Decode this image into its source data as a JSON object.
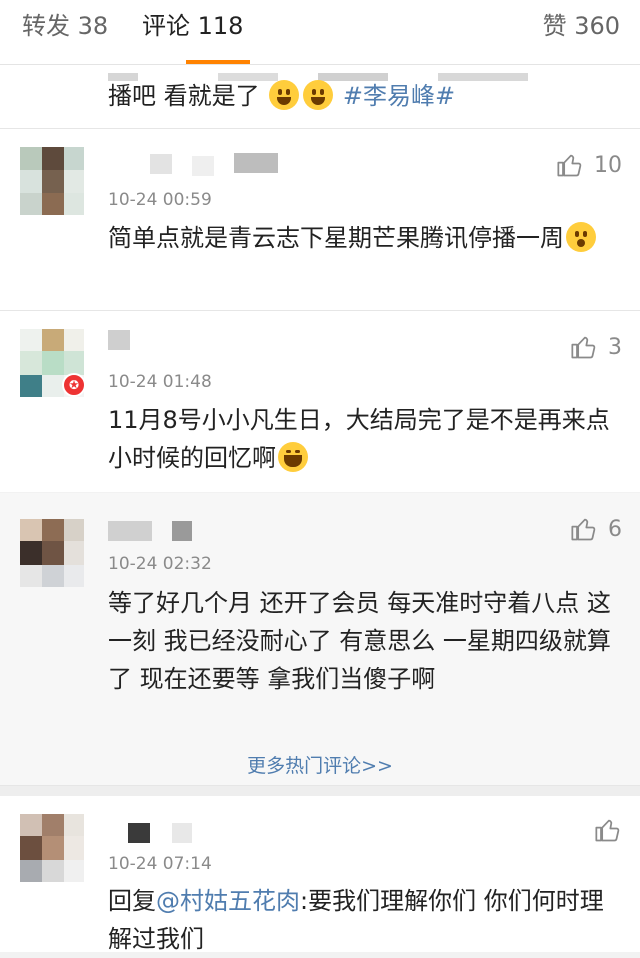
{
  "tabs": {
    "repost": "转发 38",
    "comments": "评论 118",
    "likes": "赞 360"
  },
  "colors": {
    "accent": "#ff8200",
    "link": "#507daf"
  },
  "partial_comment": {
    "text_prefix": "播吧 看就是了",
    "hashtag": "#李易峰#"
  },
  "comments": [
    {
      "time": "10-24 00:59",
      "likes": "10",
      "text": "简单点就是青云志下星期芒果腾讯停播一周"
    },
    {
      "time": "10-24 01:48",
      "likes": "3",
      "text": "11月8号小小凡生日，大结局完了是不是再来点小时候的回忆啊"
    },
    {
      "time": "10-24 02:32",
      "likes": "6",
      "text": "等了好几个月  还开了会员  每天准时守着八点 这一刻  我已经没耐心了  有意思么  一星期四级就算了  现在还要等  拿我们当傻子啊"
    }
  ],
  "more_hot_comments": "更多热门评论>>",
  "last_comment": {
    "time": "10-24 07:14",
    "reply_prefix": "回复",
    "mention": "@村姑五花肉",
    "text": ":要我们理解你们  你们何时理解过我们"
  },
  "icons": {
    "like": "thumbs-up-icon",
    "emoji": "emoji-icon",
    "verified": "verified-badge-icon"
  }
}
